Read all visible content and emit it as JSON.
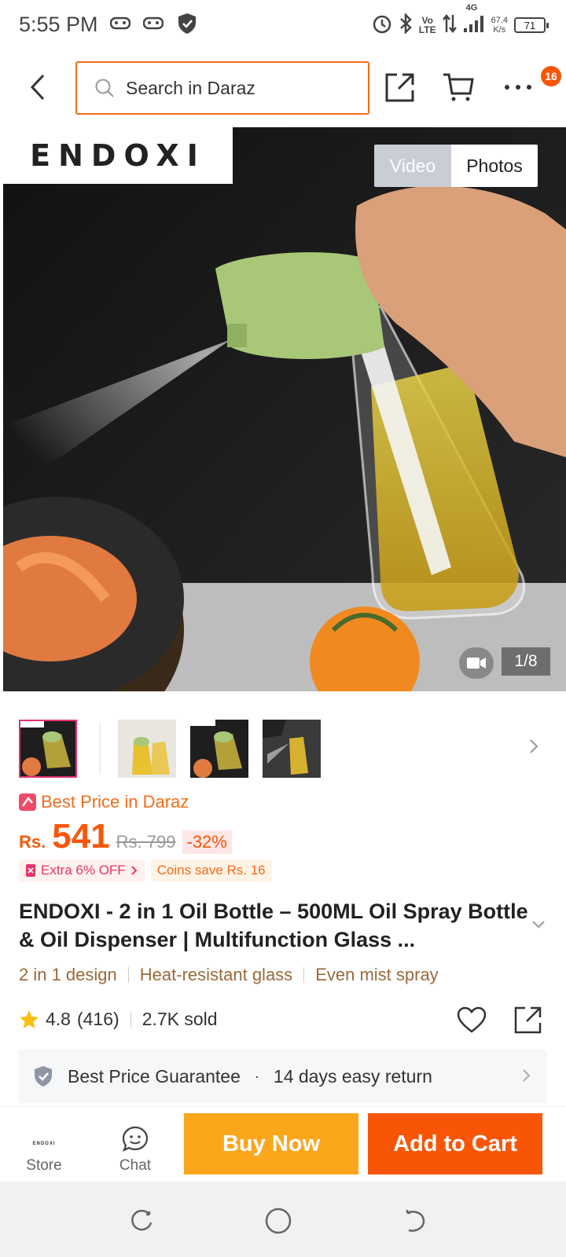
{
  "status_bar": {
    "time": "5:55 PM",
    "lte_top": "Vo",
    "lte_bottom": "LTE",
    "net_top": "4G",
    "speed_value": "67.4",
    "speed_unit": "K/s",
    "battery": "71"
  },
  "header": {
    "search_placeholder": "Search in Daraz",
    "cart_badge": "16"
  },
  "hero": {
    "brand": "ENDOXI",
    "toggle_video": "Video",
    "toggle_photos": "Photos",
    "counter": "1/8"
  },
  "price": {
    "best_price_label": "Best Price in Daraz",
    "currency": "Rs.",
    "current": "541",
    "original": "Rs. 799",
    "discount": "-32%",
    "promo_extra": "Extra 6% OFF",
    "promo_coins": "Coins save Rs. 16"
  },
  "product": {
    "title": "ENDOXI - 2 in 1 Oil Bottle – 500ML Oil Spray Bottle & Oil Dispenser | Multifunction Glass ...",
    "features": [
      "2 in 1 design",
      "Heat-resistant glass",
      "Even mist spray"
    ],
    "rating": "4.8",
    "reviews": "(416)",
    "sold": "2.7K sold"
  },
  "guarantee": {
    "best_price": "Best Price Guarantee",
    "separator": "·",
    "returns": "14 days easy return"
  },
  "bottom_bar": {
    "store_label": "Store",
    "store_logo": "ENDOXI",
    "chat_label": "Chat",
    "buy_now": "Buy Now",
    "add_to_cart": "Add to Cart"
  },
  "colors": {
    "accent": "#f85606",
    "buy_now": "#fca61c",
    "search_border": "#f36d1b"
  }
}
